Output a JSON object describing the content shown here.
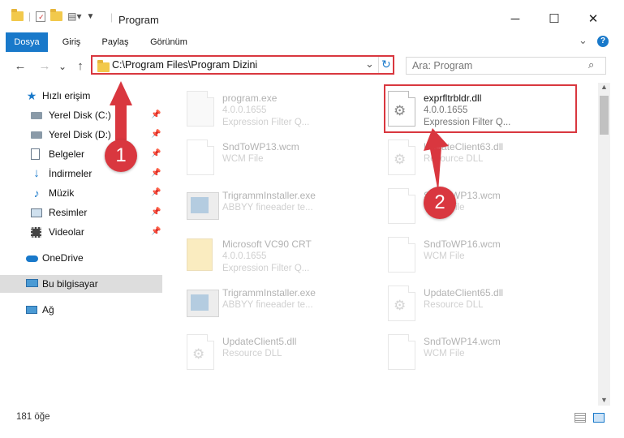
{
  "window": {
    "title": "Program",
    "minimize": "─",
    "maximize": "☐",
    "close": "✕"
  },
  "ribbon": {
    "tabs": [
      "Dosya",
      "Giriş",
      "Paylaş",
      "Görünüm"
    ],
    "expand": "⌄",
    "help": "?"
  },
  "nav": {
    "back": "←",
    "forward": "→",
    "history": "⌄",
    "up": "↑"
  },
  "address": {
    "path": "C:\\Program Files\\Program Dizini",
    "dropdown": "⌄",
    "refresh": "↻"
  },
  "search": {
    "placeholder": "Ara: Program"
  },
  "sidebar": {
    "quick_access": "Hızlı erişim",
    "items": [
      {
        "label": "Yerel Disk (C:)",
        "icon": "drive-icon"
      },
      {
        "label": "Yerel Disk (D:)",
        "icon": "drive-icon"
      },
      {
        "label": "Belgeler",
        "icon": "documents-icon"
      },
      {
        "label": "İndirmeler",
        "icon": "download-icon"
      },
      {
        "label": "Müzik",
        "icon": "music-icon"
      },
      {
        "label": "Resimler",
        "icon": "pictures-icon"
      },
      {
        "label": "Videolar",
        "icon": "videos-icon"
      }
    ],
    "onedrive": "OneDrive",
    "this_pc": "Bu bilgisayar",
    "network": "Ağ"
  },
  "files": [
    {
      "name": "program.exe",
      "line1": "4.0.0.1655",
      "line2": "Expression Filter Q...",
      "icon": "exe-icon",
      "highlight": false
    },
    {
      "name": "exprfltrbldr.dll",
      "line1": "4.0.0.1655",
      "line2": "Expression Filter Q...",
      "icon": "dll-icon",
      "highlight": true
    },
    {
      "name": "SndToWP13.wcm",
      "line1": "WCM File",
      "line2": "",
      "icon": "file-icon",
      "highlight": false
    },
    {
      "name": "UpdateClient63.dll",
      "line1": "Resource DLL",
      "line2": "",
      "icon": "dll-icon",
      "highlight": false
    },
    {
      "name": "TrigrammInstaller.exe",
      "line1": "ABBYY fineeader te...",
      "line2": "",
      "icon": "app-icon",
      "highlight": false
    },
    {
      "name": "SndToWP13.wcm",
      "line1": "WCM File",
      "line2": "",
      "icon": "file-icon",
      "highlight": false
    },
    {
      "name": "Microsoft VC90 CRT",
      "line1": "4.0.0.1655",
      "line2": "Expression Filter Q...",
      "icon": "folder-file-icon",
      "highlight": false
    },
    {
      "name": "SndToWP16.wcm",
      "line1": "WCM File",
      "line2": "",
      "icon": "file-icon",
      "highlight": false
    },
    {
      "name": "TrigrammInstaller.exe",
      "line1": "ABBYY fineeader te...",
      "line2": "",
      "icon": "app-icon",
      "highlight": false
    },
    {
      "name": "UpdateClient65.dll",
      "line1": "Resource DLL",
      "line2": "",
      "icon": "dll-icon",
      "highlight": false
    },
    {
      "name": "UpdateClient5.dll",
      "line1": "Resource DLL",
      "line2": "",
      "icon": "dll-icon",
      "highlight": false
    },
    {
      "name": "SndToWP14.wcm",
      "line1": "WCM File",
      "line2": "",
      "icon": "file-icon",
      "highlight": false
    }
  ],
  "status": {
    "count": "181 öğe"
  },
  "annotations": {
    "badge1": "1",
    "badge2": "2",
    "color": "#d9373f"
  }
}
